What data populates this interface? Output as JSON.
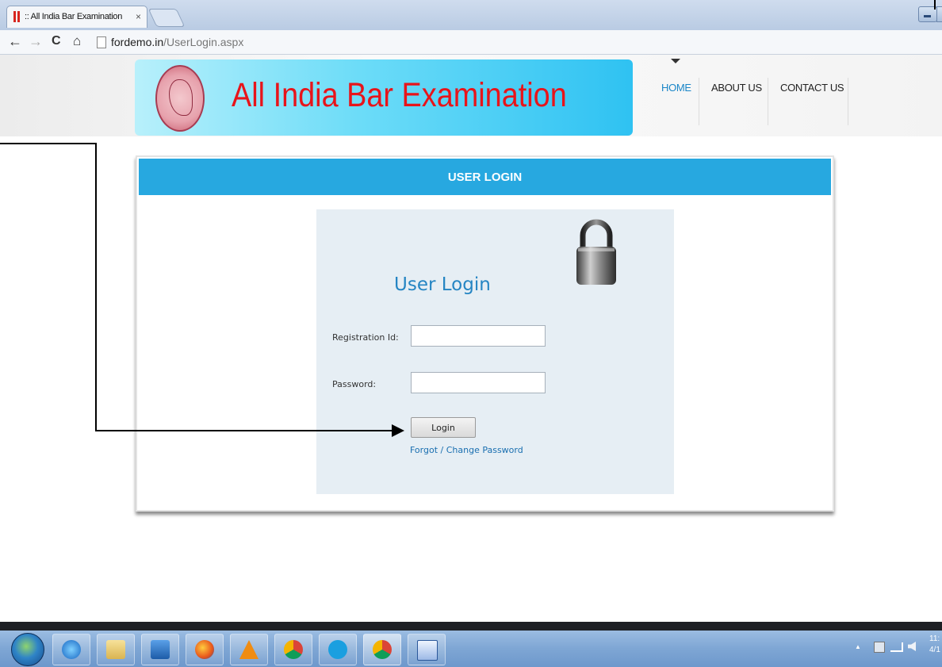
{
  "browser": {
    "tab_title": ":: All India Bar Examination",
    "tab_close": "×",
    "url_domain": "fordemo.in",
    "url_path": "/UserLogin.aspx",
    "back": "←",
    "forward": "→",
    "reload": "C",
    "home": "⌂"
  },
  "site": {
    "title": "All India Bar Examination",
    "nav": [
      "HOME",
      "ABOUT US",
      "CONTACT US"
    ],
    "active_nav": "HOME"
  },
  "login": {
    "header": "USER LOGIN",
    "form_title": "User Login",
    "registration_label": "Registration Id:",
    "registration_value": "",
    "password_label": "Password:",
    "password_value": "",
    "button_label": "Login",
    "forgot_link": "Forgot / Change Password"
  },
  "taskbar": {
    "clock_time": "11:",
    "clock_date": "4/1",
    "tray_up_arrow": "▲"
  },
  "colors": {
    "header_blue": "#27a8e0",
    "title_red": "#e8141a",
    "link_blue": "#1a6fb0",
    "form_bg": "#e6eef4"
  }
}
